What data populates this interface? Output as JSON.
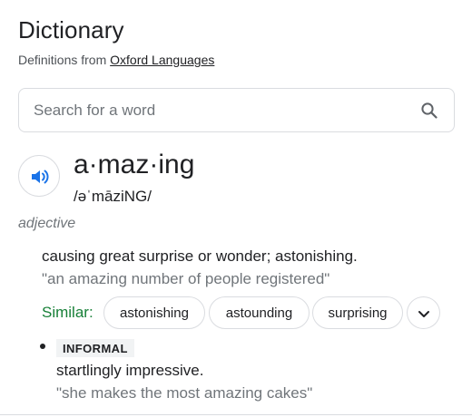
{
  "header": {
    "title": "Dictionary",
    "source_prefix": "Definitions from",
    "source_link": "Oxford Languages"
  },
  "search": {
    "placeholder": "Search for a word",
    "value": "",
    "icon": "search-icon"
  },
  "entry": {
    "pronounce_icon": "speaker-icon",
    "headword": "a·maz·ing",
    "phonetic": "/əˈmāziNG/",
    "part_of_speech": "adjective",
    "senses": [
      {
        "definition": "causing great surprise or wonder; astonishing.",
        "example": "\"an amazing number of people registered\"",
        "similar_label": "Similar:",
        "similar": [
          "astonishing",
          "astounding",
          "surprising"
        ]
      },
      {
        "register": "INFORMAL",
        "definition": "startlingly impressive.",
        "example": "\"she makes the most amazing cakes\""
      }
    ]
  },
  "colors": {
    "accent_blue": "#1a73e8",
    "similar_green": "#188038",
    "muted_text": "#70757a",
    "border": "#dadce0"
  }
}
